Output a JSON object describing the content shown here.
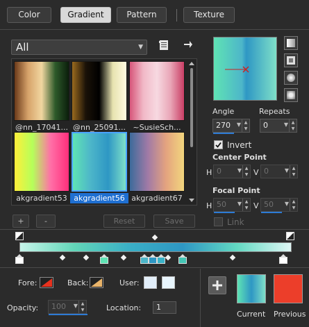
{
  "tabs": [
    {
      "label": "Color",
      "active": false
    },
    {
      "label": "Gradient",
      "active": true
    },
    {
      "label": "Pattern",
      "active": false
    },
    {
      "label": "Texture",
      "active": false
    }
  ],
  "category": {
    "value": "All"
  },
  "thumbnails": [
    {
      "label": "@nn_17041...",
      "colors": [
        "#6b3a1a",
        "#d7a36a",
        "#f1d6a0",
        "#2d5a2a",
        "#0b1e0b"
      ],
      "selected": false
    },
    {
      "label": "@nn_25091...",
      "colors": [
        "#9b6a1e",
        "#1a1208",
        "#000000",
        "#e7e3b0",
        "#fffbe0"
      ],
      "selected": false
    },
    {
      "label": "~SusieSch...",
      "colors": [
        "#d7567b",
        "#f1b9c7",
        "#f7d9e1",
        "#e9a6b7",
        "#c93e65"
      ],
      "selected": false
    },
    {
      "label": "akgradient53",
      "colors": [
        "#ffef3a",
        "#b5ff5a",
        "#ff6fa7",
        "#ff2f7b"
      ],
      "selected": false
    },
    {
      "label": "akgradient56",
      "colors": [
        "#5fe3b4",
        "#4db6c9",
        "#2e97c4",
        "#7fe0c8"
      ],
      "selected": true
    },
    {
      "label": "akgradient67",
      "colors": [
        "#3d6b9b",
        "#a17aa6",
        "#e4a37f",
        "#f2d67d"
      ],
      "selected": false
    }
  ],
  "buttons": {
    "add": "+",
    "remove": "-",
    "reset": "Reset",
    "save": "Save"
  },
  "angle": {
    "label": "Angle",
    "value": "270"
  },
  "repeats": {
    "label": "Repeats",
    "value": "0"
  },
  "invert": {
    "label": "Invert",
    "checked": true
  },
  "center_point": {
    "label": "Center Point",
    "h_label": "H",
    "h_value": "0",
    "v_label": "V",
    "v_value": "0"
  },
  "focal_point": {
    "label": "Focal Point",
    "h_label": "H",
    "h_value": "50",
    "v_label": "V",
    "v_value": "50"
  },
  "link": {
    "label": "Link",
    "checked": false
  },
  "ramp": {
    "colors": [
      "#c6f5ea",
      "#62d6b8",
      "#3ab0c6",
      "#2e97c4",
      "#62d9c2",
      "#dff7f5"
    ],
    "stops": [
      {
        "pos": 0.0,
        "color": "#ffffff"
      },
      {
        "pos": 0.31,
        "color": "#5fe3b4"
      },
      {
        "pos": 0.46,
        "color": "#4db6c9"
      },
      {
        "pos": 0.49,
        "color": "#2e97c4"
      },
      {
        "pos": 0.52,
        "color": "#3bb3c8"
      },
      {
        "pos": 0.6,
        "color": "#45c6b5"
      },
      {
        "pos": 0.97,
        "color": "#ffffff"
      }
    ]
  },
  "fore": {
    "label": "Fore:"
  },
  "back": {
    "label": "Back:"
  },
  "user": {
    "label": "User:"
  },
  "opacity": {
    "label": "Opacity:",
    "value": "100"
  },
  "location": {
    "label": "Location:",
    "value": "1"
  },
  "current": {
    "label": "Current",
    "colors": [
      "#5fe3b4",
      "#2e97c4",
      "#7fe0c8"
    ]
  },
  "previous": {
    "label": "Previous",
    "color": "#ec3e2a"
  },
  "colors": {
    "accent": "#2d7bd6",
    "selection": "#1f6fd1"
  }
}
